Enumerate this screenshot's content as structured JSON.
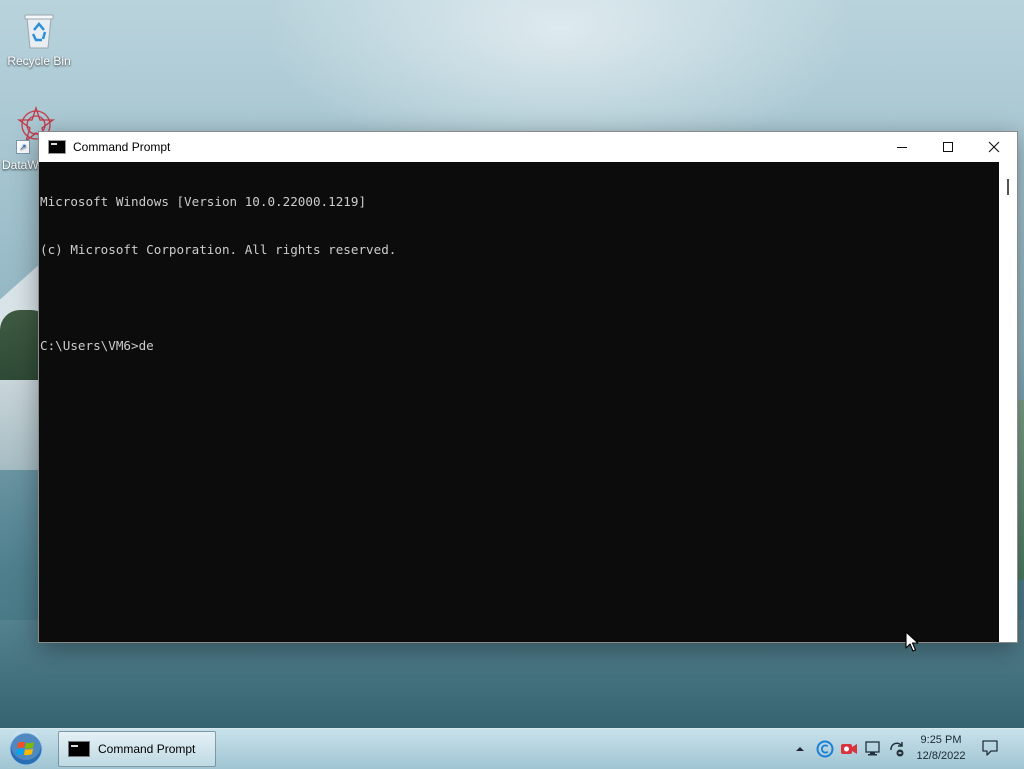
{
  "desktop": {
    "icons": [
      {
        "label": "Recycle Bin",
        "icon": "recycle-bin-icon"
      },
      {
        "label": "DataW",
        "icon": "datawatch-icon"
      }
    ]
  },
  "window": {
    "title": "Command Prompt",
    "controls": {
      "minimize": "minimize-icon",
      "maximize": "maximize-icon",
      "close": "close-icon"
    }
  },
  "console": {
    "lines": [
      "Microsoft Windows [Version 10.0.22000.1219]",
      "(c) Microsoft Corporation. All rights reserved.",
      "",
      "C:\\Users\\VM6>de"
    ]
  },
  "taskbar": {
    "start_icon": "windows-start-icon",
    "tasks": [
      {
        "label": "Command Prompt",
        "icon": "cmd-icon"
      }
    ],
    "tray": {
      "icons": [
        "chevron-up-icon",
        "copilot-c-icon",
        "camera-icon",
        "network-icon",
        "sync-icon"
      ],
      "time": "9:25 PM",
      "date": "12/8/2022",
      "notification_icon": "notification-icon"
    }
  },
  "colors": {
    "console_bg": "#0c0c0c",
    "console_fg": "#cccccc",
    "titlebar_bg": "#ffffff"
  }
}
